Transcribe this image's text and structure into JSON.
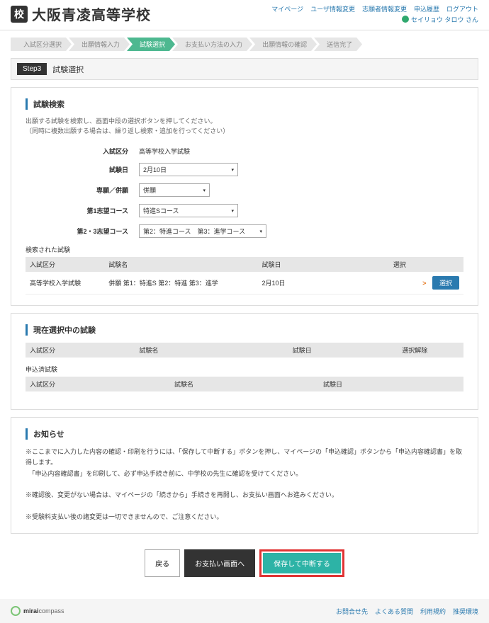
{
  "header": {
    "school_name": "大阪青凌高等学校",
    "top_links": [
      "マイページ",
      "ユーザ情報変更",
      "志願者情報変更",
      "申込履歴",
      "ログアウト"
    ],
    "user_name": "セイリョウ タロウ さん"
  },
  "stepper": {
    "items": [
      "入試区分選択",
      "出願情報入力",
      "試験選択",
      "お支払い方法の入力",
      "出願情報の確認",
      "送信完了"
    ],
    "active_index": 2
  },
  "step_title": {
    "badge": "Step3",
    "label": "試験選択"
  },
  "search": {
    "heading": "試験検索",
    "help1": "出願する試験を検索し、画面中段の選択ボタンを押してください。",
    "help2": "（同時に複数出願する場合は、繰り返し検索・追加を行ってください）",
    "fields": {
      "exam_type": {
        "label": "入試区分",
        "value": "高等学校入学試験"
      },
      "exam_date": {
        "label": "試験日",
        "value": "2月10日"
      },
      "senko": {
        "label": "専願／併願",
        "value": "併願"
      },
      "choice1": {
        "label": "第1志望コース",
        "value": "特進Sコース"
      },
      "choice23": {
        "label": "第2・3志望コース",
        "value": "第2：特進コース　第3：進学コース"
      }
    },
    "result_label": "検索された試験",
    "result_headers": [
      "入試区分",
      "試験名",
      "試験日",
      "選択"
    ],
    "result_row": {
      "exam_type": "高等学校入学試験",
      "exam_name": "併願 第1：特進S 第2：特進 第3：進学",
      "exam_date": "2月10日",
      "select_label": "選択"
    }
  },
  "selected": {
    "heading": "現在選択中の試験",
    "headers1": [
      "入試区分",
      "試験名",
      "試験日",
      "選択解除"
    ],
    "sub_label": "申込済試験",
    "headers2": [
      "入試区分",
      "試験名",
      "試験日"
    ]
  },
  "notice": {
    "heading": "お知らせ",
    "line1": "※ここまでに入力した内容の確認・印刷を行うには、「保存して中断する」ボタンを押し、マイページの「申込確認」ボタンから「申込内容確認書」を取得します。",
    "line2": "　「申込内容確認書」を印刷して、必ず申込手続き前に、中学校の先生に確認を受けてください。",
    "line3": "※確認後、変更がない場合は、マイページの「続きから」手続きを再開し、お支払い画面へお進みください。",
    "line4": "※受験料支払い後の諸変更は一切できませんので、ご注意ください。"
  },
  "actions": {
    "back": "戻る",
    "payment": "お支払い画面へ",
    "save": "保存して中断する"
  },
  "footer": {
    "brand1": "mirai",
    "brand2": "compass",
    "links": [
      "お問合せ先",
      "よくある質問",
      "利用規約",
      "推奨環境"
    ]
  }
}
